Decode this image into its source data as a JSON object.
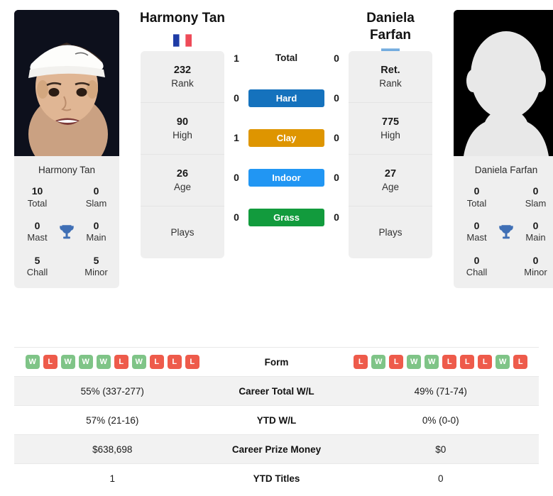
{
  "players": {
    "left": {
      "name": "Harmony Tan",
      "name_display": "Harmony Tan",
      "country": "France",
      "flag": "fr-flag-icon",
      "photo": "player-photo",
      "titles_name": "Harmony Tan",
      "titles": {
        "total": "10",
        "total_label": "Total",
        "slam": "0",
        "slam_label": "Slam",
        "mast": "0",
        "mast_label": "Mast",
        "main": "0",
        "main_label": "Main",
        "chall": "5",
        "chall_label": "Chall",
        "minor": "5",
        "minor_label": "Minor"
      },
      "rank": "232",
      "rank_label": "Rank",
      "high": "90",
      "high_label": "High",
      "age": "26",
      "age_label": "Age",
      "plays": "Plays",
      "form": [
        "W",
        "L",
        "W",
        "W",
        "W",
        "L",
        "W",
        "L",
        "L",
        "L"
      ],
      "career_wl": "55% (337-277)",
      "ytd_wl": "57% (21-16)",
      "prize_money": "$638,698",
      "ytd_titles": "1"
    },
    "right": {
      "name": "Daniela Farfan",
      "name_line1": "Daniela",
      "name_line2": "Farfan",
      "country": "Argentina",
      "flag": "ar-flag-icon",
      "photo": "player-photo-placeholder",
      "titles_name": "Daniela Farfan",
      "titles": {
        "total": "0",
        "total_label": "Total",
        "slam": "0",
        "slam_label": "Slam",
        "mast": "0",
        "mast_label": "Mast",
        "main": "0",
        "main_label": "Main",
        "chall": "0",
        "chall_label": "Chall",
        "minor": "0",
        "minor_label": "Minor"
      },
      "rank": "Ret.",
      "rank_label": "Rank",
      "high": "775",
      "high_label": "High",
      "age": "27",
      "age_label": "Age",
      "plays": "Plays",
      "form": [
        "L",
        "W",
        "L",
        "W",
        "W",
        "L",
        "L",
        "L",
        "W",
        "L"
      ],
      "career_wl": "49% (71-74)",
      "ytd_wl": "0% (0-0)",
      "prize_money": "$0",
      "ytd_titles": "0"
    }
  },
  "h2h": {
    "total_label": "Total",
    "total_left": "1",
    "total_right": "0",
    "surfaces": [
      {
        "label": "Hard",
        "color": "#1572bd",
        "left": "0",
        "right": "0"
      },
      {
        "label": "Clay",
        "color": "#de9500",
        "left": "1",
        "right": "0"
      },
      {
        "label": "Indoor",
        "color": "#2196f3",
        "left": "0",
        "right": "0"
      },
      {
        "label": "Grass",
        "color": "#129b3d",
        "left": "0",
        "right": "0"
      }
    ]
  },
  "table": {
    "rows": [
      {
        "label": "Form",
        "type": "form"
      },
      {
        "label": "Career Total W/L",
        "type": "text",
        "left": "55% (337-277)",
        "right": "49% (71-74)"
      },
      {
        "label": "YTD W/L",
        "type": "text",
        "left": "57% (21-16)",
        "right": "0% (0-0)"
      },
      {
        "label": "Career Prize Money",
        "type": "text",
        "left": "$638,698",
        "right": "$0"
      },
      {
        "label": "YTD Titles",
        "type": "text",
        "left": "1",
        "right": "0"
      }
    ]
  },
  "colors": {
    "win": "#7fc487",
    "loss": "#ee5b4b",
    "card_bg": "#efefef",
    "trophy": "#3f6fb5"
  }
}
